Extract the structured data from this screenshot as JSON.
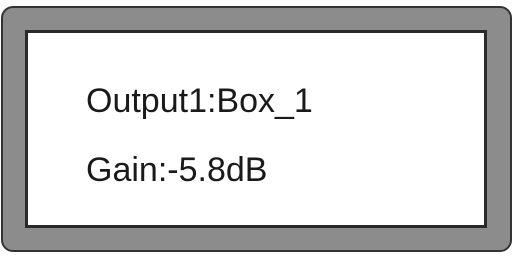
{
  "display": {
    "output_line": "Output1:Box_1",
    "gain_line": "Gain:-5.8dB"
  },
  "colors": {
    "frame": "#8c8c8c",
    "frame_border": "#333333",
    "screen_background": "#ffffff",
    "text": "#1a1a1a"
  }
}
